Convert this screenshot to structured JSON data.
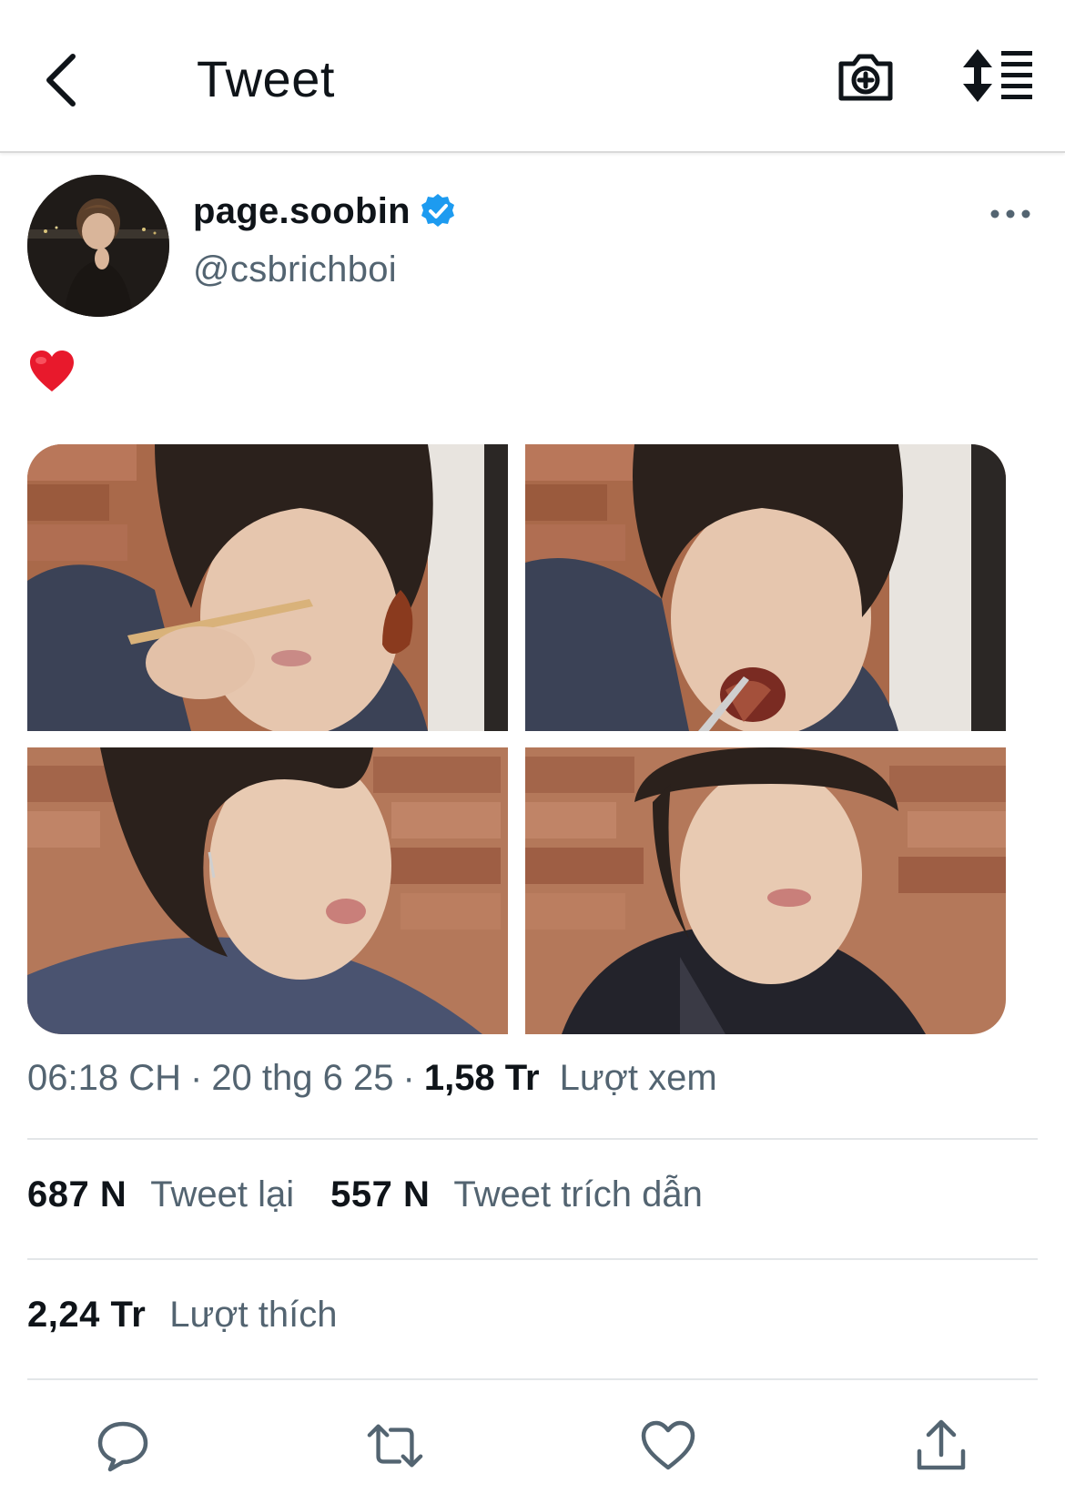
{
  "header": {
    "title": "Tweet",
    "back_icon": "chevron-left-icon",
    "camera_icon": "camera-plus-icon",
    "sort_icon": "sort-lines-icon"
  },
  "tweet": {
    "author": {
      "display_name": "page.soobin",
      "handle": "@csbrichboi",
      "verified": true,
      "badge_color": "#1d9bf0"
    },
    "text": "❤️",
    "media_count": 4,
    "meta": {
      "time": "06:18 CH",
      "separator": "·",
      "date": "20 thg 6 25",
      "views_count": "1,58 Tr",
      "views_label": "Lượt xem"
    },
    "stats": {
      "retweets_count": "687 N",
      "retweets_label": "Tweet lại",
      "quotes_count": "557 N",
      "quotes_label": "Tweet trích dẫn",
      "likes_count": "2,24 Tr",
      "likes_label": "Lượt thích"
    }
  },
  "actions": {
    "reply_icon": "reply-bubble-icon",
    "retweet_icon": "retweet-icon",
    "like_icon": "heart-icon",
    "share_icon": "share-upload-icon"
  },
  "colors": {
    "text_primary": "#0f1419",
    "text_secondary": "#536471",
    "icon_gray": "#536471",
    "divider": "#e3e6e8"
  }
}
